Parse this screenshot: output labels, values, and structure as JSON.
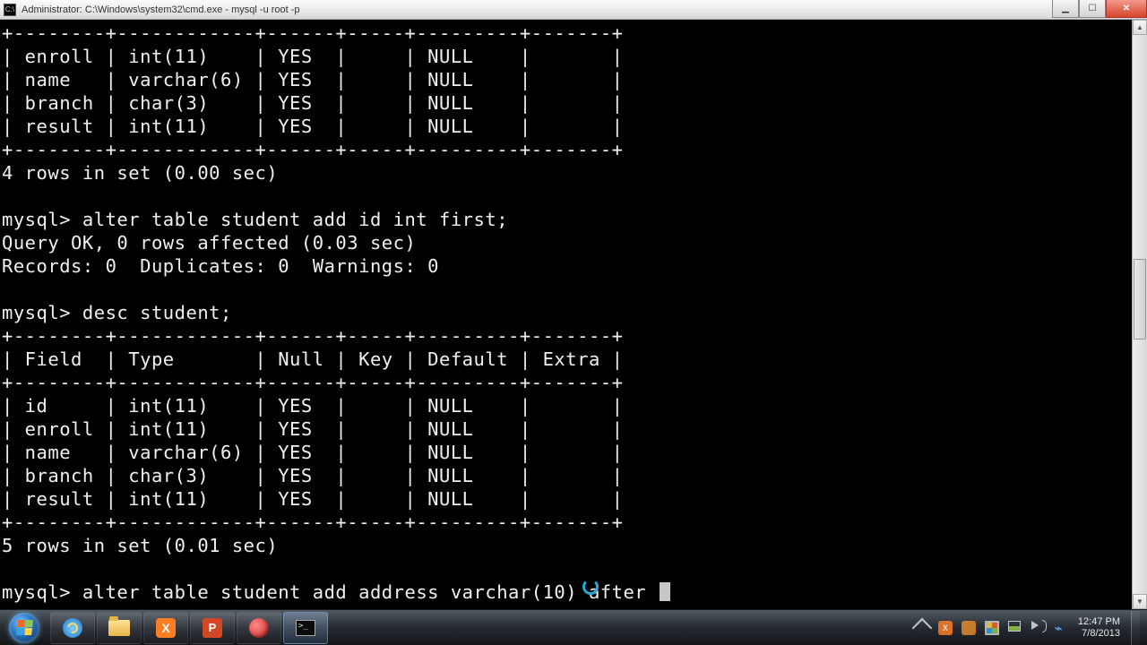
{
  "titlebar": {
    "text": "Administrator: C:\\Windows\\system32\\cmd.exe - mysql  -u root -p"
  },
  "term": {
    "border_top": "+--------+------------+------+-----+---------+-------+",
    "t1_r1": "| enroll | int(11)    | YES  |     | NULL    |       |",
    "t1_r2": "| name   | varchar(6) | YES  |     | NULL    |       |",
    "t1_r3": "| branch | char(3)    | YES  |     | NULL    |       |",
    "t1_r4": "| result | int(11)    | YES  |     | NULL    |       |",
    "t1_summary": "4 rows in set (0.00 sec)",
    "cmd1": "mysql> alter table student add id int first;",
    "res1a": "Query OK, 0 rows affected (0.03 sec)",
    "res1b": "Records: 0  Duplicates: 0  Warnings: 0",
    "cmd2": "mysql> desc student;",
    "t2_header": "| Field  | Type       | Null | Key | Default | Extra |",
    "t2_r1": "| id     | int(11)    | YES  |     | NULL    |       |",
    "t2_r2": "| enroll | int(11)    | YES  |     | NULL    |       |",
    "t2_r3": "| name   | varchar(6) | YES  |     | NULL    |       |",
    "t2_r4": "| branch | char(3)    | YES  |     | NULL    |       |",
    "t2_r5": "| result | int(11)    | YES  |     | NULL    |       |",
    "t2_summary": "5 rows in set (0.01 sec)",
    "cmd3": "mysql> alter table student add address varchar(10) after"
  },
  "tray": {
    "time": "12:47 PM",
    "date": "7/8/2013"
  },
  "taskbar": {
    "xampp_letter": "X",
    "ppt_letter": "P"
  }
}
